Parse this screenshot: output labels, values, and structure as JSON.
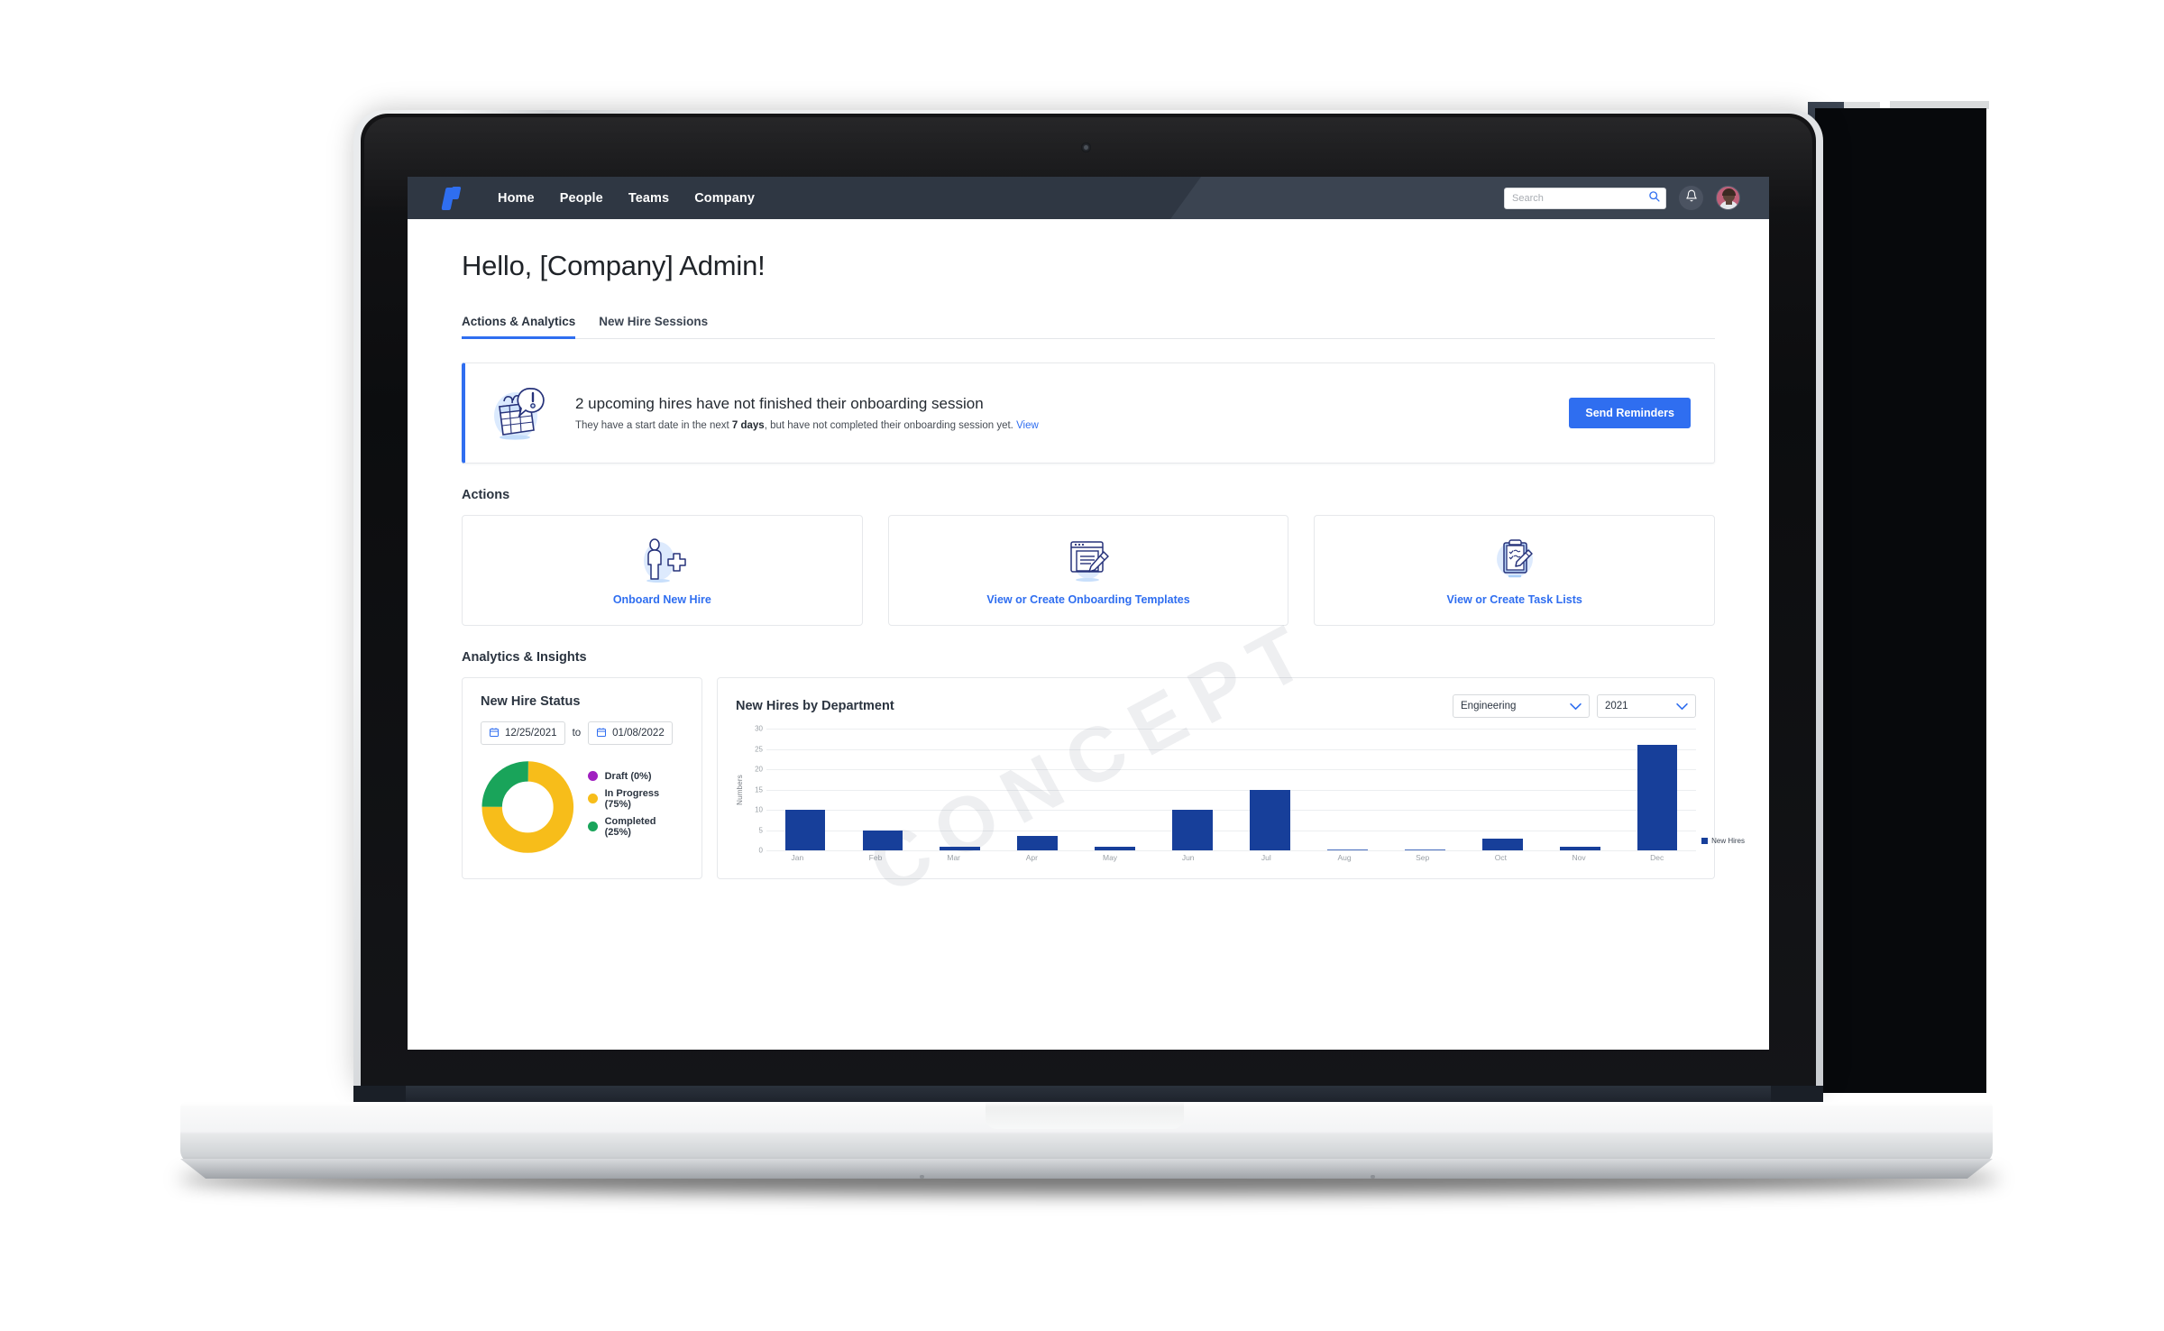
{
  "navbar": {
    "logo_icon": "brand-logo-icon",
    "links": [
      "Home",
      "People",
      "Teams",
      "Company"
    ],
    "search": {
      "placeholder": "Search",
      "value": "",
      "icon": "search-icon"
    },
    "notification_icon": "bell-icon",
    "avatar_label": "user-avatar"
  },
  "page": {
    "greeting": "Hello, [Company] Admin!",
    "tabs": [
      {
        "label": "Actions & Analytics",
        "active": true
      },
      {
        "label": "New Hire Sessions",
        "active": false
      }
    ]
  },
  "banner": {
    "illustration": "calendar-alert-illustration",
    "title": "2 upcoming hires have not finished their onboarding session",
    "sub_before": "They have a start date in the next ",
    "sub_bold": "7 days",
    "sub_after": ", but have not completed their onboarding session yet. ",
    "view_link": "View",
    "button": "Send Reminders",
    "accent_color": "#2f6ef0"
  },
  "actions": {
    "heading": "Actions",
    "cards": [
      {
        "label": "Onboard New Hire",
        "icon": "person-plus-illustration"
      },
      {
        "label": "View or Create Onboarding Templates",
        "icon": "document-pencil-illustration"
      },
      {
        "label": "View or Create Task Lists",
        "icon": "clipboard-pencil-illustration"
      }
    ]
  },
  "analytics": {
    "heading": "Analytics & Insights",
    "status": {
      "title": "New Hire Status",
      "date_from": "12/25/2021",
      "date_to_label": "to",
      "date_to": "01/08/2022",
      "calendar_icon": "calendar-icon"
    },
    "department_chart": {
      "title": "New Hires by Department",
      "department_selected": "Engineering",
      "year_selected": "2021",
      "watermark": "CONCEPT"
    }
  },
  "chart_data": [
    {
      "type": "pie",
      "title": "New Hire Status",
      "labels": [
        "Draft (0%)",
        "In Progress (75%)",
        "Completed (25%)"
      ],
      "names": [
        "Draft",
        "In Progress",
        "Completed"
      ],
      "values": [
        0,
        75,
        25
      ],
      "colors": [
        "#a020c0",
        "#f7bd1a",
        "#19a45a"
      ],
      "legend_position": "right",
      "donut": true
    },
    {
      "type": "bar",
      "title": "New Hires by Department",
      "categories": [
        "Jan",
        "Feb",
        "Mar",
        "Apr",
        "May",
        "Jun",
        "Jul",
        "Aug",
        "Sep",
        "Oct",
        "Nov",
        "Dec"
      ],
      "series": [
        {
          "name": "New Hires",
          "values": [
            10,
            5,
            1,
            3.5,
            1,
            10,
            15,
            0.2,
            0.2,
            3,
            1,
            26
          ]
        }
      ],
      "xlabel": "",
      "ylabel": "Numbers",
      "ylim": [
        0,
        30
      ],
      "yticks": [
        0,
        5,
        10,
        15,
        20,
        25,
        30
      ],
      "grid": true,
      "legend": [
        "New Hires"
      ],
      "legend_position": "right",
      "bar_color": "#173f9a"
    }
  ]
}
